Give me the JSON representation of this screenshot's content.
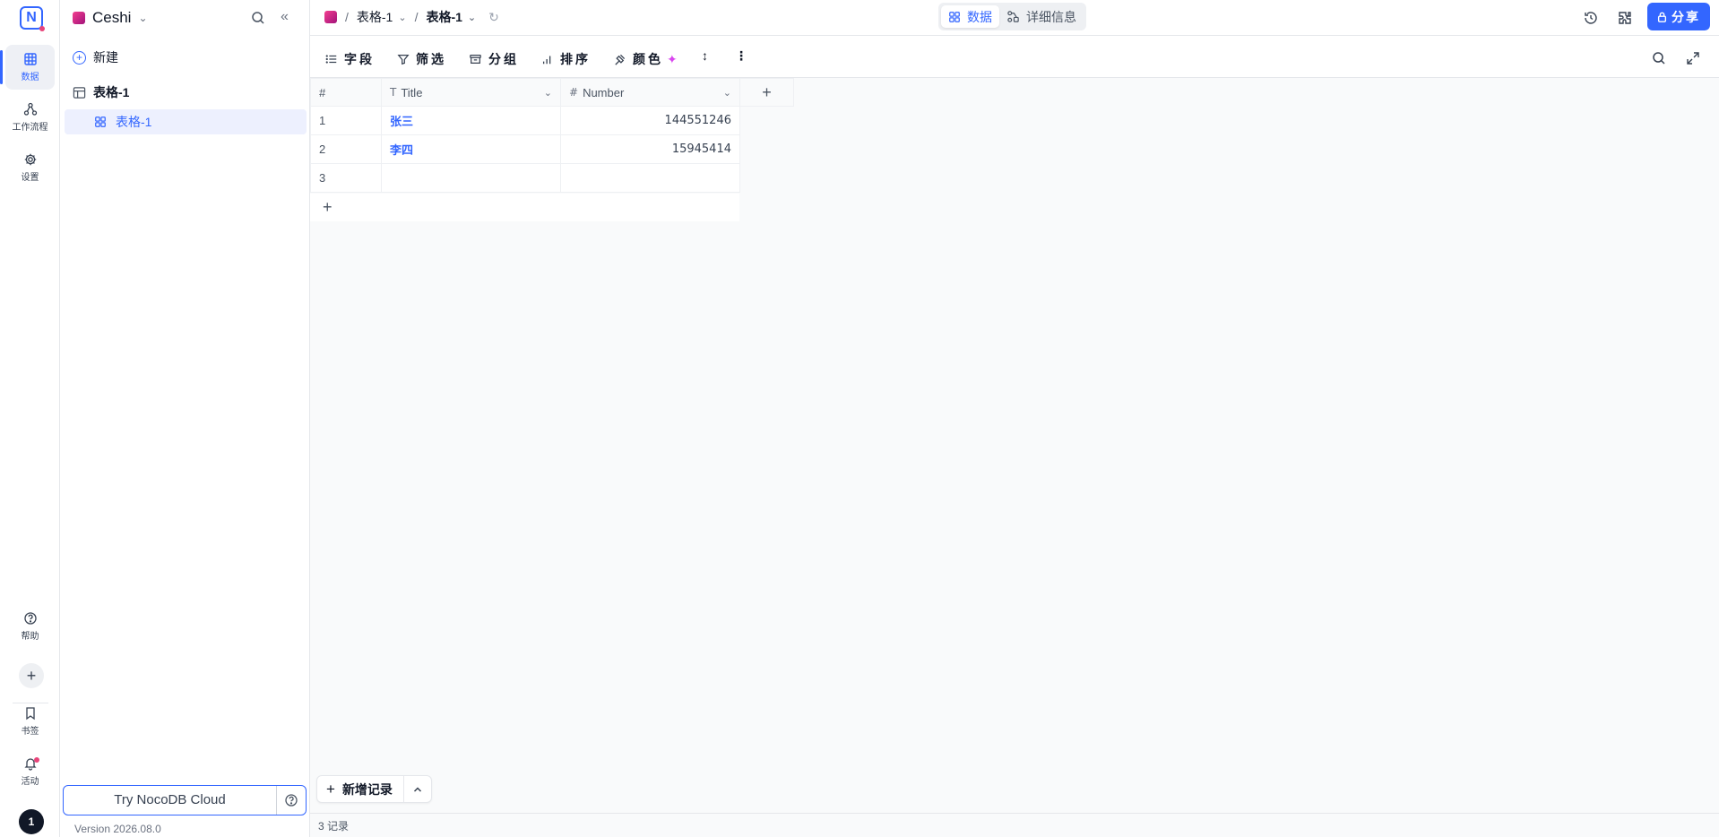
{
  "rail": {
    "logo": "N",
    "items": [
      {
        "label": "数据",
        "icon": "table-icon"
      },
      {
        "label": "工作流程",
        "icon": "workflow-icon"
      },
      {
        "label": "设置",
        "icon": "gear-icon"
      }
    ],
    "bottom": [
      {
        "label": "帮助",
        "icon": "help-icon"
      },
      {
        "label": "书签",
        "icon": "bookmark-icon"
      },
      {
        "label": "活动",
        "icon": "bell-icon"
      }
    ],
    "user_initial": "1"
  },
  "sidebar": {
    "base_name": "Ceshi",
    "new_label": "新建",
    "table_name": "表格-1",
    "view_name": "表格-1",
    "cloud_label": "Try NocoDB Cloud",
    "version": "Version 2026.08.0"
  },
  "topbar": {
    "breadcrumb": [
      "表格-1",
      "表格-1"
    ],
    "tabs": [
      {
        "label": "数据",
        "active": true
      },
      {
        "label": "详细信息",
        "active": false
      }
    ],
    "share_label": "分享"
  },
  "toolbar": {
    "fields": "字段",
    "filter": "筛选",
    "group": "分组",
    "sort": "排序",
    "color": "颜色"
  },
  "grid": {
    "headers": [
      "#",
      "Title",
      "Number"
    ],
    "rows": [
      {
        "index": "1",
        "title": "张三",
        "number": "144551246"
      },
      {
        "index": "2",
        "title": "李四",
        "number": "15945414"
      },
      {
        "index": "3",
        "title": "",
        "number": ""
      }
    ],
    "add_record_label": "新增记录",
    "record_count": "3 记录"
  }
}
